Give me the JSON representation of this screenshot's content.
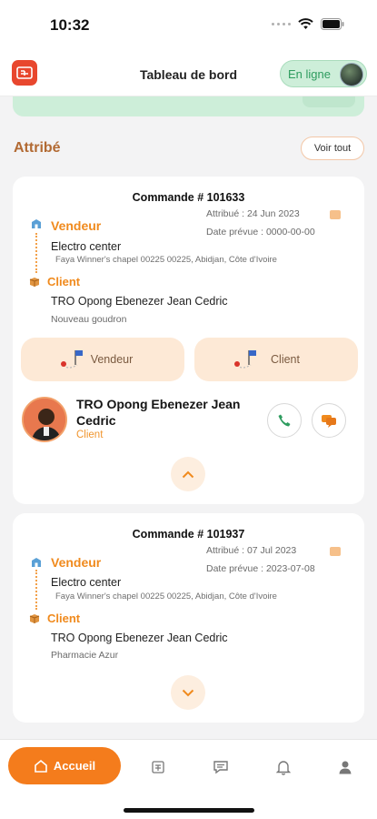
{
  "status_bar": {
    "time": "10:32"
  },
  "header": {
    "title": "Tableau de bord",
    "status_label": "En ligne"
  },
  "section": {
    "title": "Attribé",
    "see_all_label": "Voir tout"
  },
  "orders": [
    {
      "title": "Commande # 101633",
      "vendor_label": "Vendeur",
      "assigned": "Attribué : 24 Jun 2023",
      "planned": "Date prévue : 0000-00-00",
      "store_name": "Electro center",
      "address": "Faya Winner's chapel 00225 00225, Abidjan, Côte d'Ivoire",
      "client_label": "Client",
      "client_name": "TRO Opong Ebenezer Jean Cedric",
      "client_place": "Nouveau goudron",
      "route_buttons": [
        "Vendeur",
        "Client"
      ],
      "contact": {
        "name": "TRO Opong Ebenezer Jean Cedric",
        "role": "Client"
      },
      "expanded": true
    },
    {
      "title": "Commande # 101937",
      "vendor_label": "Vendeur",
      "assigned": "Attribué : 07 Jul 2023",
      "planned": "Date prévue : 2023-07-08",
      "store_name": "Electro center",
      "address": "Faya Winner's chapel 00225 00225, Abidjan, Côte d'Ivoire",
      "client_label": "Client",
      "client_name": "TRO Opong Ebenezer Jean Cedric",
      "client_place": "Pharmacie Azur",
      "expanded": false
    }
  ],
  "tabbar": {
    "home_label": "Accueil",
    "items": [
      "home-icon",
      "orders-icon",
      "chat-icon",
      "bell-icon",
      "user-icon"
    ]
  },
  "colors": {
    "accent": "#f47c1c",
    "online": "#2e9c5f",
    "section_title": "#b26a33"
  }
}
